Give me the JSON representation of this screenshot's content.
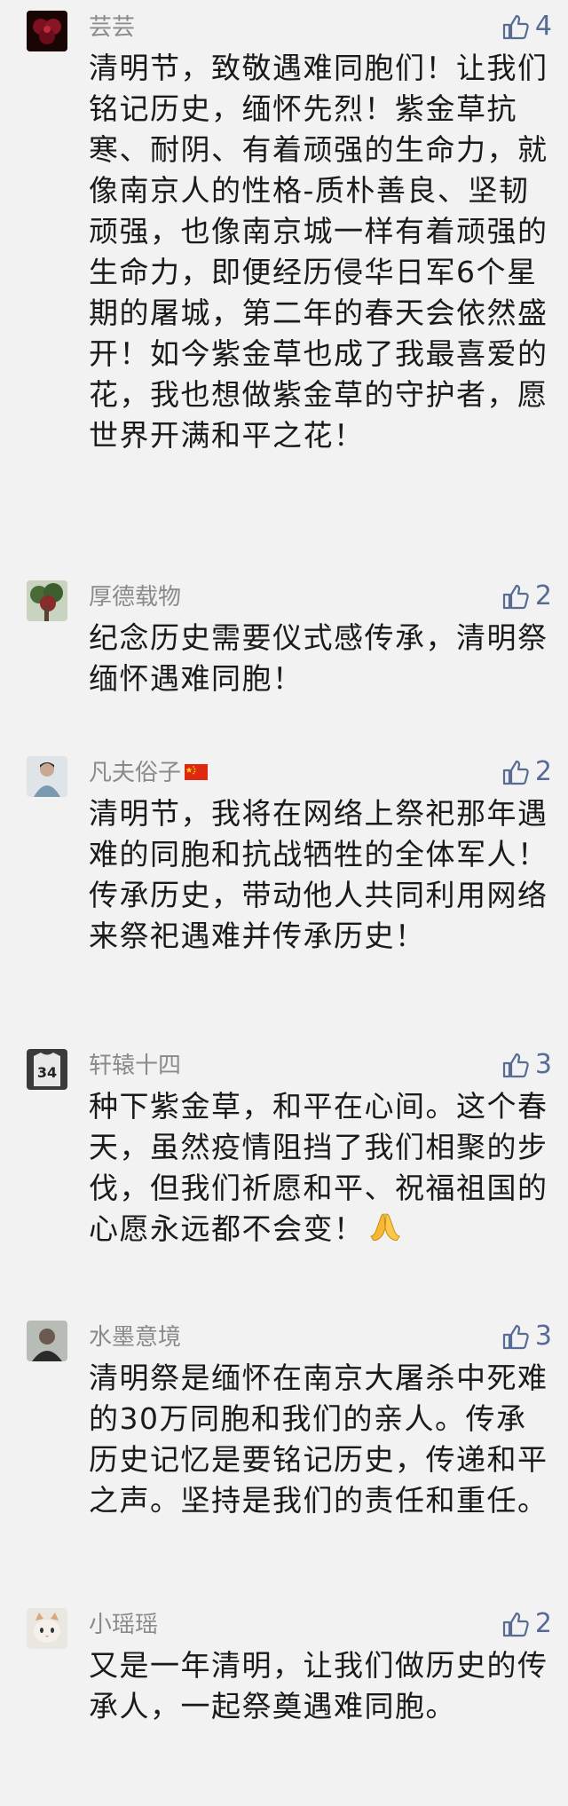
{
  "colors": {
    "background": "#f2f2f2",
    "name": "#8a8a8a",
    "text": "#1a1a1a",
    "like": "#576b95"
  },
  "comments": [
    {
      "avatar": "flower-avatar",
      "name": "芸芸",
      "likes": "4",
      "text": "清明节，致敬遇难同胞们！让我们铭记历史，缅怀先烈！紫金草抗寒、耐阴、有着顽强的生命力，就像南京人的性格-质朴善良、坚韧顽强，也像南京城一样有着顽强的生命力，即便经历侵华日军6个星期的屠城，第二年的春天会依然盛开！如今紫金草也成了我最喜爱的花，我也想做紫金草的守护者，愿世界开满和平之花！"
    },
    {
      "avatar": "tree-avatar",
      "name": "厚德载物",
      "likes": "2",
      "text": "纪念历史需要仪式感传承，清明祭缅怀遇难同胞！"
    },
    {
      "avatar": "person-avatar",
      "name": "凡夫俗子",
      "flag": "china-flag-icon",
      "likes": "2",
      "text": "清明节，我将在网络上祭祀那年遇难的同胞和抗战牺牲的全体军人！传承历史，带动他人共同利用网络来祭祀遇难并传承历史！"
    },
    {
      "avatar": "jersey-avatar",
      "name": "轩辕十四",
      "likes": "3",
      "text": "种下紫金草，和平在心间。这个春天，虽然疫情阻挡了我们相聚的步伐，但我们祈愿和平、祝福祖国的心愿永远都不会变！",
      "emoji": "folded-hands-emoji"
    },
    {
      "avatar": "portrait-avatar",
      "name": "水墨意境",
      "likes": "3",
      "text": "清明祭是缅怀在南京大屠杀中死难的30万同胞和我们的亲人。传承历史记忆是要铭记历史，传递和平之声。坚持是我们的责任和重任。"
    },
    {
      "avatar": "cat-avatar",
      "name": "小瑶瑶",
      "likes": "2",
      "text": "又是一年清明，让我们做历史的传承人，一起祭奠遇难同胞。"
    }
  ]
}
